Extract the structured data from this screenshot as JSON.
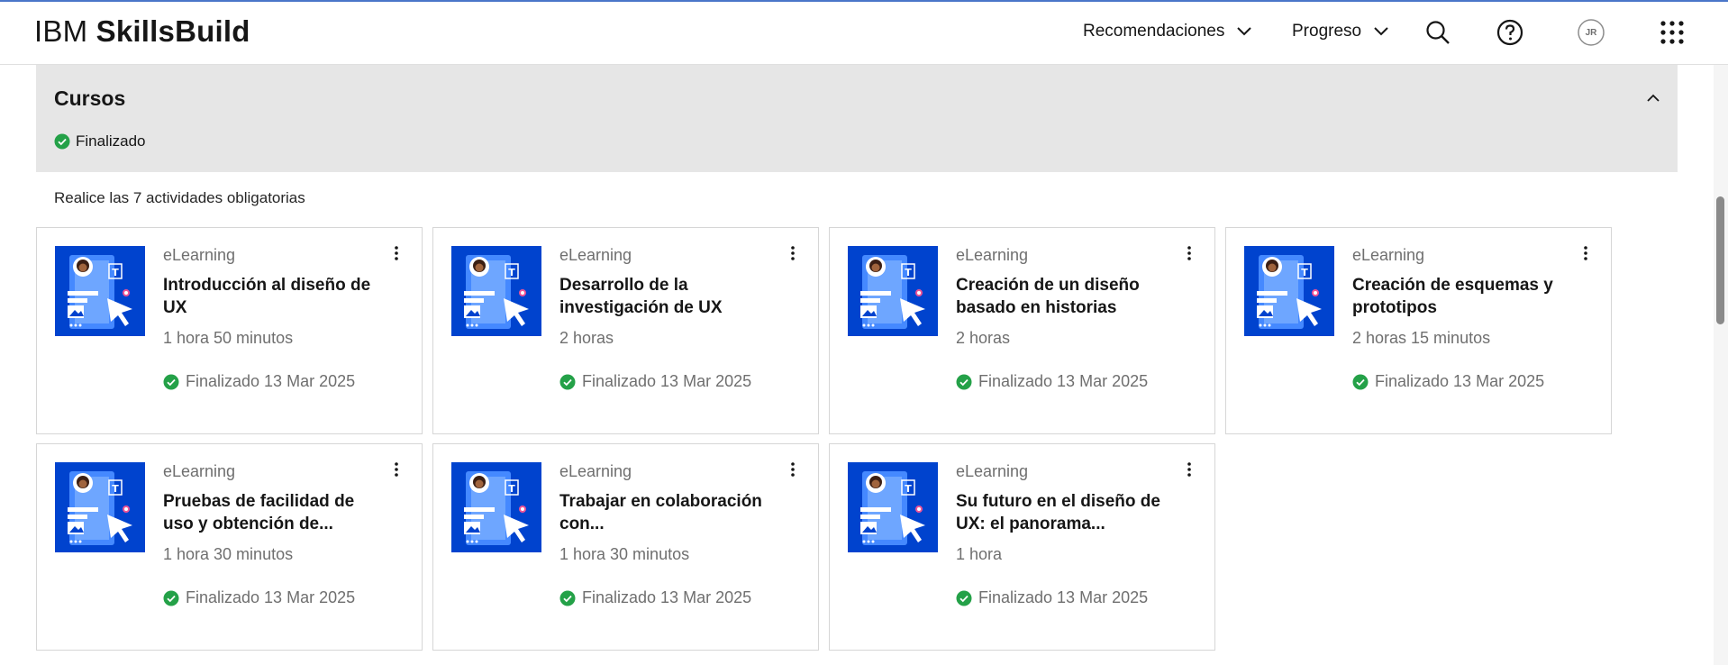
{
  "header": {
    "brand_light": "IBM",
    "brand_bold": "SkillsBuild",
    "nav": [
      {
        "label": "Recomendaciones"
      },
      {
        "label": "Progreso"
      }
    ],
    "avatar_initials": "JR",
    "icons": [
      "search-icon",
      "help-icon",
      "avatar",
      "app-switcher-icon"
    ]
  },
  "section": {
    "title": "Cursos",
    "status": "Finalizado",
    "required_text": "Realice las 7 actividades obligatorias"
  },
  "colors": {
    "accent": "#0043ce",
    "success": "#24a148",
    "panel_bg": "#e6e6e6"
  },
  "courses": [
    {
      "type": "eLearning",
      "title": "Introducción al diseño de UX",
      "duration": "1 hora 50 minutos",
      "status": "Finalizado 13 Mar 2025"
    },
    {
      "type": "eLearning",
      "title": "Desarrollo de la investigación de UX",
      "duration": "2 horas",
      "status": "Finalizado 13 Mar 2025"
    },
    {
      "type": "eLearning",
      "title": "Creación de un diseño basado en historias",
      "duration": "2 horas",
      "status": "Finalizado 13 Mar 2025"
    },
    {
      "type": "eLearning",
      "title": "Creación de esquemas y prototipos",
      "duration": "2 horas 15 minutos",
      "status": "Finalizado 13 Mar 2025"
    },
    {
      "type": "eLearning",
      "title": "Pruebas de facilidad de uso y obtención de...",
      "duration": "1 hora 30 minutos",
      "status": "Finalizado 13 Mar 2025"
    },
    {
      "type": "eLearning",
      "title": "Trabajar en colaboración con...",
      "duration": "1 hora 30 minutos",
      "status": "Finalizado 13 Mar 2025"
    },
    {
      "type": "eLearning",
      "title": "Su futuro en el diseño de UX: el panorama...",
      "duration": "1 hora",
      "status": "Finalizado 13 Mar 2025"
    }
  ]
}
